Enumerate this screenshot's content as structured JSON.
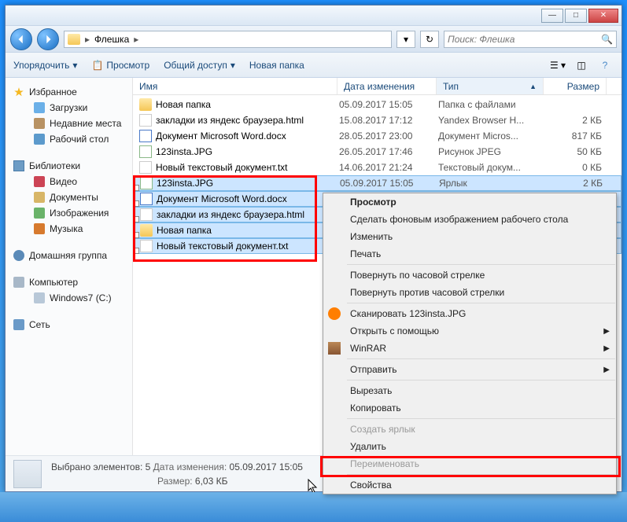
{
  "breadcrumb": {
    "folder": "Флешка"
  },
  "search": {
    "placeholder": "Поиск: Флешка"
  },
  "toolbar": {
    "organize": "Упорядочить",
    "view": "Просмотр",
    "share": "Общий доступ",
    "new_folder": "Новая папка"
  },
  "sidebar": {
    "favorites": "Избранное",
    "downloads": "Загрузки",
    "recent": "Недавние места",
    "desktop": "Рабочий стол",
    "libraries": "Библиотеки",
    "video": "Видео",
    "documents": "Документы",
    "images": "Изображения",
    "music": "Музыка",
    "homegroup": "Домашняя группа",
    "computer": "Компьютер",
    "drive_c": "Windows7 (C:)",
    "network": "Сеть"
  },
  "columns": {
    "name": "Имя",
    "date": "Дата изменения",
    "type": "Тип",
    "size": "Размер"
  },
  "files": [
    {
      "name": "Новая папка",
      "date": "05.09.2017 15:05",
      "type": "Папка с файлами",
      "size": "",
      "icon": "folder"
    },
    {
      "name": "закладки из яндекс браузера.html",
      "date": "15.08.2017 17:12",
      "type": "Yandex Browser H...",
      "size": "2 КБ",
      "icon": "html"
    },
    {
      "name": "Документ Microsoft Word.docx",
      "date": "28.05.2017 23:00",
      "type": "Документ Micros...",
      "size": "817 КБ",
      "icon": "docx"
    },
    {
      "name": "123insta.JPG",
      "date": "26.05.2017 17:46",
      "type": "Рисунок JPEG",
      "size": "50 КБ",
      "icon": "jpg"
    },
    {
      "name": "Новый текстовый документ.txt",
      "date": "14.06.2017 21:24",
      "type": "Текстовый докум...",
      "size": "0 КБ",
      "icon": "txt"
    },
    {
      "name": "123insta.JPG",
      "date": "05.09.2017 15:05",
      "type": "Ярлык",
      "size": "2 КБ",
      "icon": "jpg",
      "selected": true,
      "shortcut": true
    },
    {
      "name": "Документ Microsoft Word.docx",
      "date": "",
      "type": "",
      "size": "",
      "icon": "docx",
      "selected": true,
      "shortcut": true
    },
    {
      "name": "закладки из яндекс браузера.html",
      "date": "",
      "type": "",
      "size": "",
      "icon": "html",
      "selected": true,
      "shortcut": true
    },
    {
      "name": "Новая папка",
      "date": "",
      "type": "",
      "size": "",
      "icon": "folder",
      "selected": true,
      "shortcut": true
    },
    {
      "name": "Новый текстовый документ.txt",
      "date": "",
      "type": "",
      "size": "",
      "icon": "txt",
      "selected": true,
      "shortcut": true
    }
  ],
  "context_menu": {
    "view": "Просмотр",
    "set_wallpaper": "Сделать фоновым изображением рабочего стола",
    "change": "Изменить",
    "print": "Печать",
    "rotate_cw": "Повернуть по часовой стрелке",
    "rotate_ccw": "Повернуть против часовой стрелки",
    "scan": "Сканировать 123insta.JPG",
    "open_with": "Открыть с помощью",
    "winrar": "WinRAR",
    "send_to": "Отправить",
    "cut": "Вырезать",
    "copy": "Копировать",
    "create_shortcut": "Создать ярлык",
    "delete": "Удалить",
    "rename": "Переименовать",
    "properties": "Свойства"
  },
  "status": {
    "selected_count_label": "Выбрано элементов: 5",
    "date_label": "Дата изменения:",
    "date_value": "05.09.2017 15:05",
    "size_label": "Размер:",
    "size_value": "6,03 КБ"
  }
}
